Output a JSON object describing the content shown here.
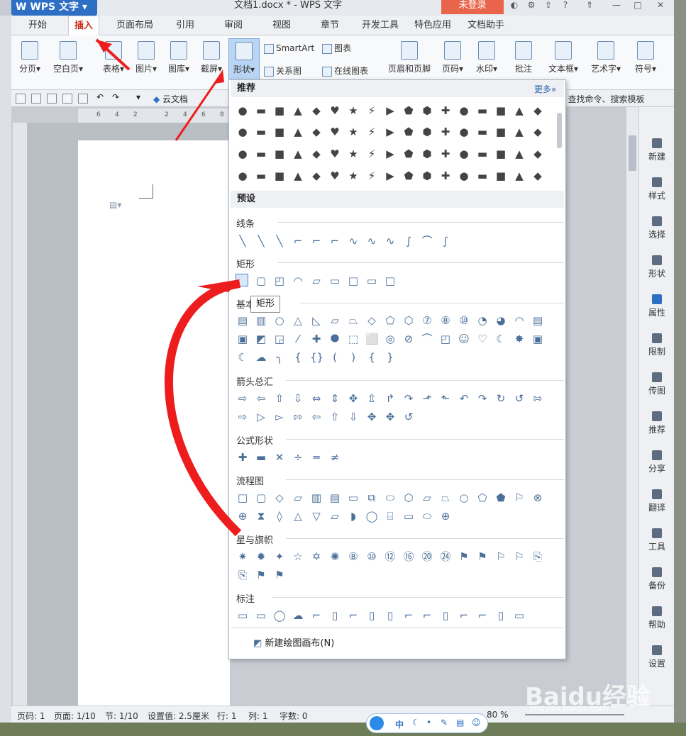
{
  "window": {
    "app_name": "WPS 文字",
    "title": "文档1.docx * - WPS 文字",
    "login": "未登录"
  },
  "menu": {
    "tabs": [
      "开始",
      "插入",
      "页面布局",
      "引用",
      "审阅",
      "视图",
      "章节",
      "开发工具",
      "特色应用",
      "文档助手"
    ],
    "active": "插入"
  },
  "ribbon": {
    "buttons": [
      "分页",
      "空白页",
      "表格",
      "图片",
      "图库",
      "截屏",
      "形状",
      "页眉和页脚",
      "页码",
      "水印",
      "批注",
      "文本框",
      "艺术字",
      "符号"
    ],
    "small": [
      "SmartArt",
      "图表",
      "关系图",
      "在线图表"
    ],
    "selected": "形状"
  },
  "quickbar": {
    "cloud_doc": "云文档",
    "find": "查找命令、搜索模板"
  },
  "shapes_menu": {
    "recommend_title": "推荐",
    "more": "更多»",
    "preset_title": "预设",
    "groups": [
      "线条",
      "矩形",
      "基本形状",
      "箭头总汇",
      "公式形状",
      "流程图",
      "星与旗帜",
      "标注"
    ],
    "tooltip": "矩形",
    "new_canvas": "新建绘图画布(N)"
  },
  "right_panel": [
    "新建",
    "样式",
    "选择",
    "形状",
    "属性",
    "限制",
    "传图",
    "推荐",
    "分享",
    "翻译",
    "工具",
    "备份",
    "帮助",
    "设置"
  ],
  "status": {
    "page": "页码: 1",
    "pages": "页面: 1/10",
    "section": "节: 1/10",
    "setting": "设置值: 2.5厘米",
    "row": "行: 1",
    "col": "列: 1",
    "words": "字数: 0",
    "zoom": "80 %"
  },
  "ime": {
    "lang": "中"
  },
  "watermark": {
    "brand": "Baidu经验",
    "url": "jingyan.baidu.com"
  },
  "ruler_h": [
    "6",
    "4",
    "2",
    "2",
    "4",
    "6",
    "8"
  ],
  "colors": {
    "accent": "#c82f1d",
    "annotation": "#ee1d1d",
    "brand": "#2c6fc4"
  }
}
